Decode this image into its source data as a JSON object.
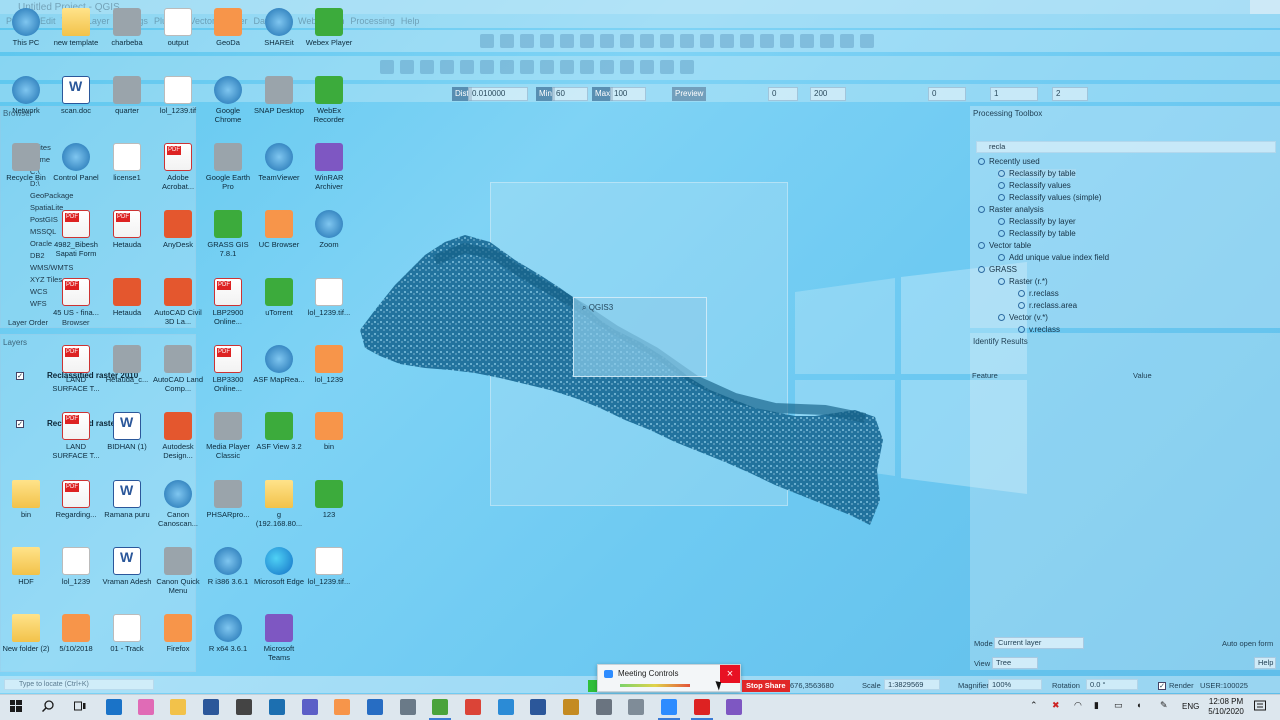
{
  "window": {
    "title": "Untitled Project - QGIS"
  },
  "menu": [
    "Project",
    "Edit",
    "View",
    "Layer",
    "Settings",
    "Plugins",
    "Vector",
    "Raster",
    "Database",
    "Web",
    "Mesh",
    "Processing",
    "Help"
  ],
  "toolbar3": {
    "dist_label": "Dist",
    "dist_value": "0.010000",
    "min_label": "Min",
    "min_value": "60",
    "max_label": "Max",
    "max_value": "100",
    "preview": "Preview",
    "f1": "0",
    "f2": "200",
    "f3": "0",
    "f4": "1",
    "f5": "2"
  },
  "left_panels": {
    "browser_title": "Browser",
    "browser_items": [
      "Favorites",
      "Home",
      "C:\\",
      "D:\\",
      "GeoPackage",
      "SpatiaLite",
      "PostGIS",
      "MSSQL",
      "Oracle",
      "DB2",
      "WMS/WMTS",
      "XYZ Tiles",
      "WCS",
      "WFS"
    ],
    "tabs": [
      "Layer Order",
      "Browser"
    ],
    "layers_title": "Layers",
    "layers": [
      {
        "name": "Reclassified raster 2010",
        "checked": true
      },
      {
        "name": "Reclassified raster 1990",
        "checked": true
      }
    ]
  },
  "desktop_icons": [
    {
      "label": "This PC",
      "kind": "blue"
    },
    {
      "label": "new template",
      "kind": "folder"
    },
    {
      "label": "charbeba",
      "kind": "gray"
    },
    {
      "label": "output",
      "kind": "file"
    },
    {
      "label": "GeoDa",
      "kind": "orange"
    },
    {
      "label": "SHAREit",
      "kind": "blue"
    },
    {
      "label": "Webex Player",
      "kind": "green"
    },
    {
      "label": "Network",
      "kind": "blue"
    },
    {
      "label": "scan.doc",
      "kind": "word"
    },
    {
      "label": "quarter",
      "kind": "gray"
    },
    {
      "label": "lol_1239.tif",
      "kind": "file"
    },
    {
      "label": "Google Chrome",
      "kind": "blue"
    },
    {
      "label": "SNAP Desktop",
      "kind": "gray"
    },
    {
      "label": "WebEx Recorder",
      "kind": "green"
    },
    {
      "label": "Recycle Bin",
      "kind": "gray"
    },
    {
      "label": "Control Panel",
      "kind": "blue"
    },
    {
      "label": "license1",
      "kind": "file"
    },
    {
      "label": "Adobe Acrobat...",
      "kind": "pdf"
    },
    {
      "label": "Google Earth Pro",
      "kind": "gray"
    },
    {
      "label": "TeamViewer",
      "kind": "blue"
    },
    {
      "label": "WinRAR Archiver",
      "kind": "purple"
    },
    {
      "label": "4982_Bibesh Sapati Form",
      "kind": "pdf"
    },
    {
      "label": "Hetauda",
      "kind": "pdf"
    },
    {
      "label": "AnyDesk",
      "kind": "red"
    },
    {
      "label": "GRASS GIS 7.8.1",
      "kind": "green"
    },
    {
      "label": "UC Browser",
      "kind": "orange"
    },
    {
      "label": "Zoom",
      "kind": "blue"
    },
    {
      "label": "45 US - fina...",
      "kind": "pdf"
    },
    {
      "label": "Hetauda",
      "kind": "red"
    },
    {
      "label": "AutoCAD Civil 3D La...",
      "kind": "red"
    },
    {
      "label": "LBP2900 Online...",
      "kind": "pdf"
    },
    {
      "label": "uTorrent",
      "kind": "green"
    },
    {
      "label": "lol_1239.tif...",
      "kind": "file"
    },
    {
      "label": "LAND SURFACE T...",
      "kind": "pdf"
    },
    {
      "label": "Hetauda_c...",
      "kind": "gray"
    },
    {
      "label": "AutoCAD Land Comp...",
      "kind": "gray"
    },
    {
      "label": "LBP3300 Online...",
      "kind": "pdf"
    },
    {
      "label": "ASF MapRea...",
      "kind": "blue"
    },
    {
      "label": "lol_1239",
      "kind": "orange"
    },
    {
      "label": "LAND SURFACE T...",
      "kind": "pdf"
    },
    {
      "label": "BIDHAN (1)",
      "kind": "word"
    },
    {
      "label": "Autodesk Design...",
      "kind": "red"
    },
    {
      "label": "Media Player Classic",
      "kind": "gray"
    },
    {
      "label": "ASF View 3.2",
      "kind": "green"
    },
    {
      "label": "bin",
      "kind": "orange"
    },
    {
      "label": "bin",
      "kind": "folder"
    },
    {
      "label": "Regarding...",
      "kind": "pdf"
    },
    {
      "label": "Ramana puru",
      "kind": "word"
    },
    {
      "label": "Canon Canoscan...",
      "kind": "blue"
    },
    {
      "label": "PHSARpro...",
      "kind": "gray"
    },
    {
      "label": "g (192.168.80...",
      "kind": "folder"
    },
    {
      "label": "123",
      "kind": "green"
    },
    {
      "label": "HDF",
      "kind": "folder"
    },
    {
      "label": "lol_1239",
      "kind": "file"
    },
    {
      "label": "Vraman Adesh",
      "kind": "word"
    },
    {
      "label": "Canon Quick Menu",
      "kind": "gray"
    },
    {
      "label": "R i386 3.6.1",
      "kind": "blue"
    },
    {
      "label": "Microsoft Edge",
      "kind": "edge"
    },
    {
      "label": "lol_1239.tif...",
      "kind": "file"
    },
    {
      "label": "New folder (2)",
      "kind": "folder"
    },
    {
      "label": "5/10/2018",
      "kind": "orange"
    },
    {
      "label": "01 - Track",
      "kind": "file"
    },
    {
      "label": "Firefox",
      "kind": "orange"
    },
    {
      "label": "R x64 3.6.1",
      "kind": "blue"
    },
    {
      "label": "Microsoft Teams",
      "kind": "purple"
    }
  ],
  "splash": {
    "label": "QGIS3"
  },
  "processing_toolbox": {
    "title": "Processing Toolbox",
    "search_value": "recla",
    "rows": [
      {
        "label": "Recently used",
        "indent": 0,
        "group": true
      },
      {
        "label": "Reclassify by table",
        "indent": 1,
        "selected": true
      },
      {
        "label": "Reclassify values",
        "indent": 1
      },
      {
        "label": "Reclassify values (simple)",
        "indent": 1
      },
      {
        "label": "Raster analysis",
        "indent": 0,
        "group": true
      },
      {
        "label": "Reclassify by layer",
        "indent": 1
      },
      {
        "label": "Reclassify by table",
        "indent": 1
      },
      {
        "label": "Vector table",
        "indent": 0,
        "group": true
      },
      {
        "label": "Add unique value index field",
        "indent": 1
      },
      {
        "label": "GRASS",
        "indent": 0,
        "group": true
      },
      {
        "label": "Raster (r.*)",
        "indent": 1,
        "group": true
      },
      {
        "label": "r.reclass",
        "indent": 2
      },
      {
        "label": "r.reclass.area",
        "indent": 2
      },
      {
        "label": "Vector (v.*)",
        "indent": 1,
        "group": true
      },
      {
        "label": "v.reclass",
        "indent": 2
      }
    ]
  },
  "identify": {
    "title": "Identify Results",
    "col_feature": "Feature",
    "col_value": "Value",
    "mode_label": "Mode",
    "mode_value": "Current layer",
    "view_label": "View",
    "view_value": "Tree",
    "auto_open": "Auto open form",
    "help": "Help"
  },
  "statusbar": {
    "locate_placeholder": "Type to locate (Ctrl+K)",
    "coordinate": "676,3563680",
    "scale_label": "Scale",
    "scale_value": "1:3829569",
    "magnifier_label": "Magnifier",
    "magnifier_value": "100%",
    "rotation_label": "Rotation",
    "rotation_value": "0.0 °",
    "render_label": "Render",
    "crs": "USER:100025"
  },
  "meeting": {
    "title": "Meeting Controls",
    "close": "×",
    "stop_share": "Stop Share"
  },
  "taskbar": {
    "lang": "ENG",
    "time": "12:08 PM",
    "date": "5/10/2020"
  },
  "colors": {
    "desktop": "#6ecaf2",
    "nepal_map": "#1d6e99",
    "stop_share": "#e02828",
    "close": "#e81123"
  }
}
